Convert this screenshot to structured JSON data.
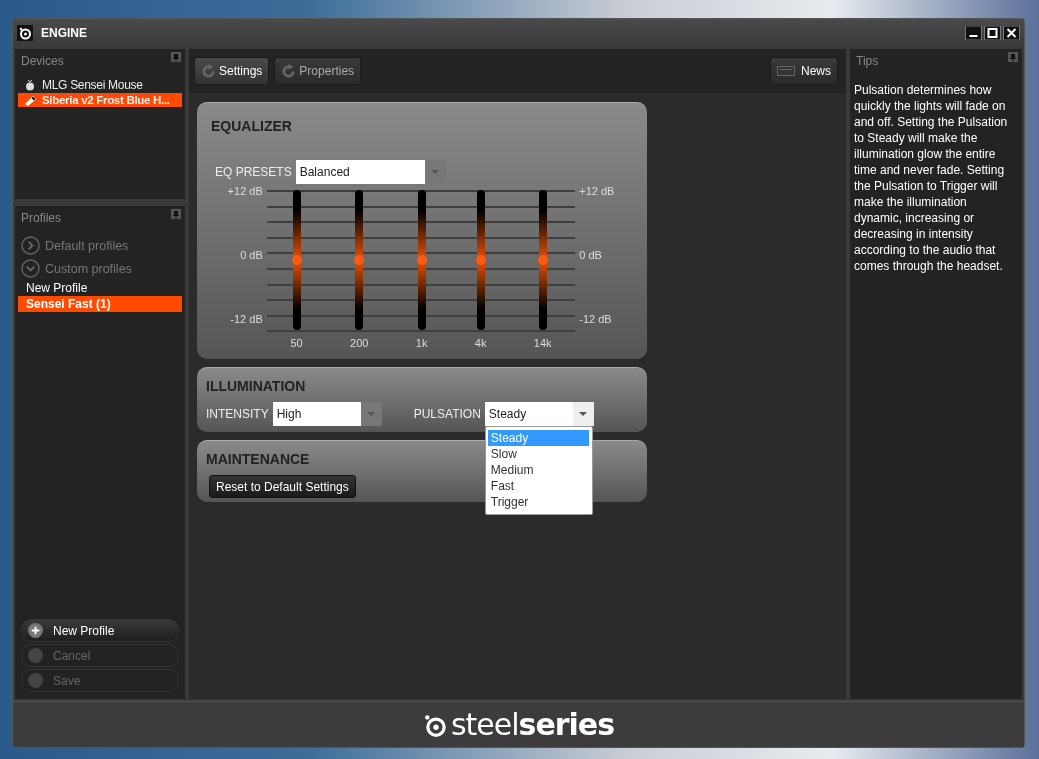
{
  "window": {
    "title": "ENGINE"
  },
  "devices": {
    "title": "Devices",
    "items": [
      {
        "kind": "mouse",
        "label": "MLG Sensei Mouse",
        "selected": false
      },
      {
        "kind": "headset",
        "label": "Siberia v2 Frost Blue H...",
        "selected": true
      }
    ]
  },
  "profiles": {
    "title": "Profiles",
    "groups": [
      {
        "label": "Default profiles",
        "expanded": false
      },
      {
        "label": "Custom profiles",
        "expanded": true,
        "children": [
          {
            "label": "New Profile",
            "selected": false
          },
          {
            "label": "Sensei Fast (1)",
            "selected": true
          }
        ]
      }
    ],
    "buttons": [
      {
        "kind": "add",
        "label": "New Profile",
        "disabled": false
      },
      {
        "kind": "plain",
        "label": "Cancel",
        "disabled": true
      },
      {
        "kind": "plain",
        "label": "Save",
        "disabled": true
      }
    ]
  },
  "toolbar": {
    "tabs": [
      {
        "label": "Settings",
        "selected": true
      },
      {
        "label": "Properties",
        "selected": false
      }
    ],
    "news": "News"
  },
  "equalizer": {
    "title": "EQUALIZER",
    "presets_label": "EQ PRESETS",
    "preset": "Balanced",
    "scale_left": [
      "+12 dB",
      "0 dB",
      "-12 dB"
    ],
    "scale_right": [
      "+12 dB",
      "0 dB",
      "-12 dB"
    ],
    "bands": [
      {
        "label": "50",
        "level": 0.5
      },
      {
        "label": "200",
        "level": 0.5
      },
      {
        "label": "1k",
        "level": 0.5
      },
      {
        "label": "4k",
        "level": 0.5
      },
      {
        "label": "14k",
        "level": 0.5
      }
    ]
  },
  "illumination": {
    "title": "ILLUMINATION",
    "intensity_label": "INTENSITY",
    "intensity": "High",
    "pulsation_label": "PULSATION",
    "pulsation": "Steady",
    "pulsation_open": true,
    "pulsation_options": [
      {
        "label": "Steady",
        "selected": true
      },
      {
        "label": "Slow",
        "selected": false
      },
      {
        "label": "Medium",
        "selected": false
      },
      {
        "label": "Fast",
        "selected": false
      },
      {
        "label": "Trigger",
        "selected": false
      }
    ]
  },
  "maintenance": {
    "title": "MAINTENANCE",
    "reset": "Reset to Default Settings"
  },
  "tips": {
    "title": "Tips",
    "text": "Pulsation determines how quickly the lights will fade on and off. Setting the Pulsation to Steady will make the illumination glow the entire time and never fade. Setting the Pulsation to Trigger will make the illumination dynamic, increasing or decreasing in intensity according to the audio that comes through the headset."
  },
  "footer": {
    "logo": "steel**series**"
  }
}
